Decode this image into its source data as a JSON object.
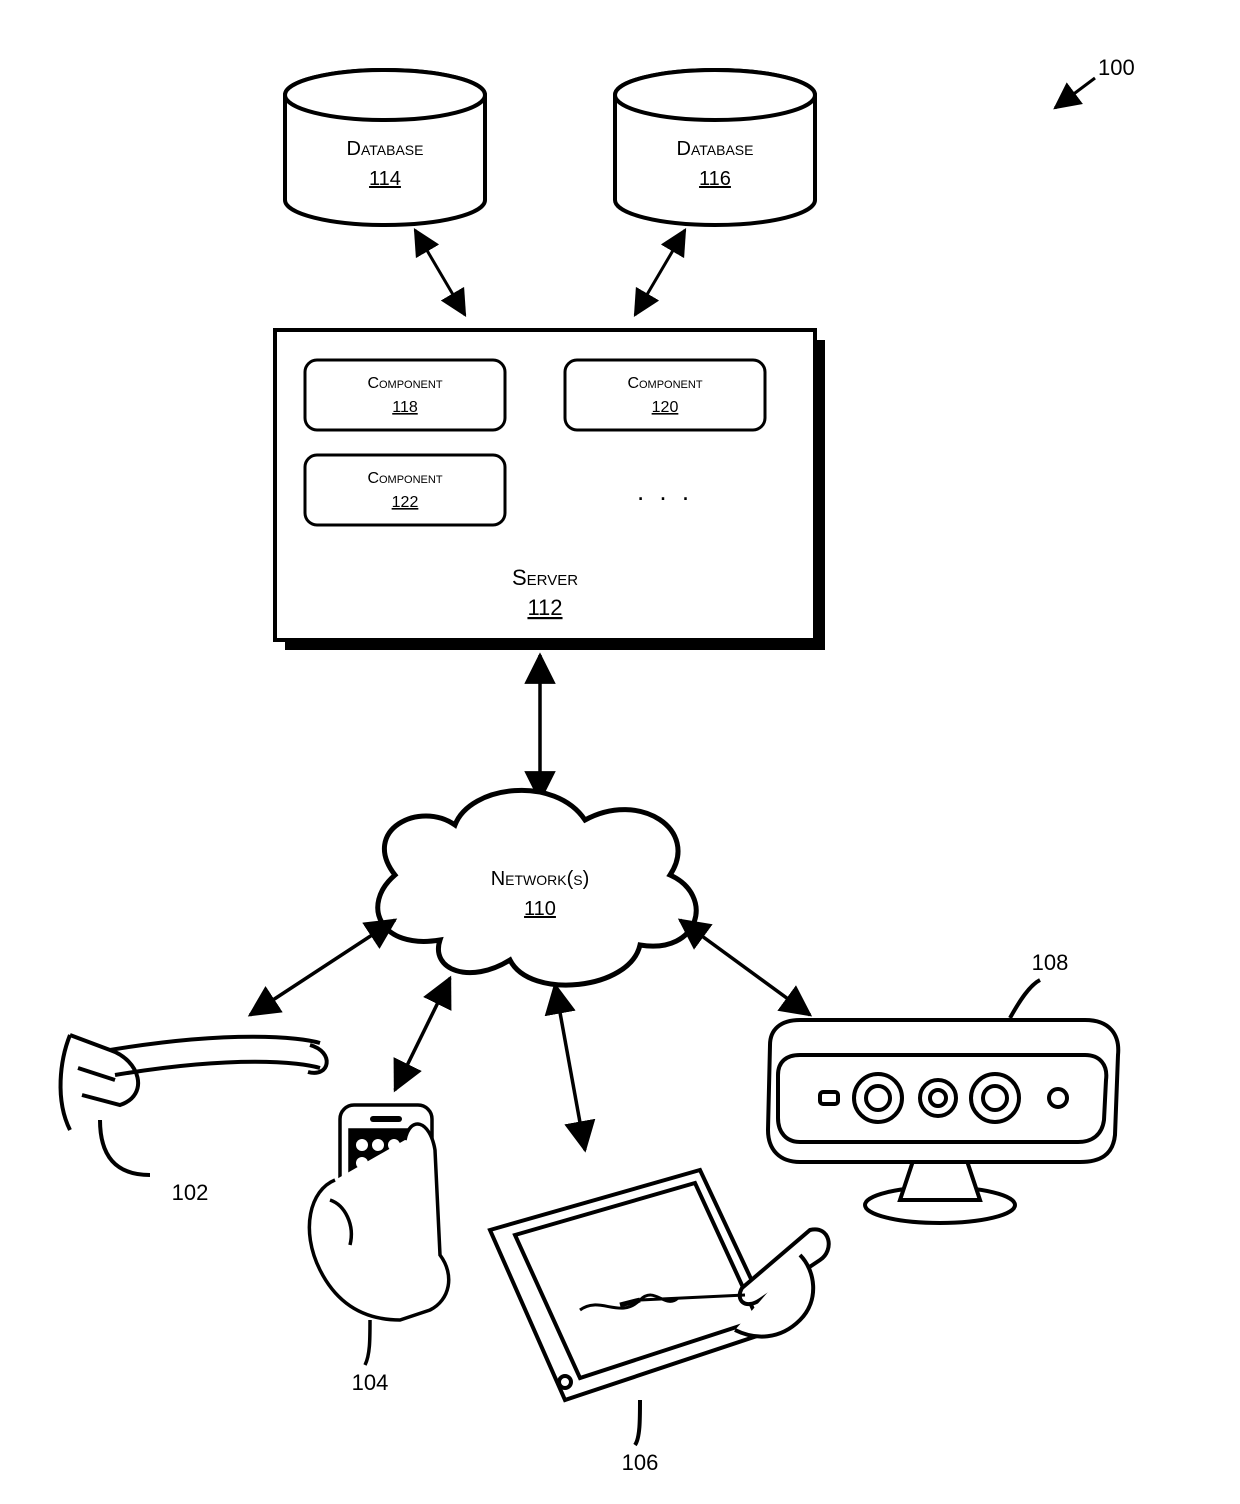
{
  "system_ref": "100",
  "databases": [
    {
      "label": "Database",
      "ref": "114"
    },
    {
      "label": "Database",
      "ref": "116"
    }
  ],
  "server": {
    "label": "Server",
    "ref": "112",
    "ellipsis": ". . .",
    "components": [
      {
        "label": "Component",
        "ref": "118"
      },
      {
        "label": "Component",
        "ref": "120"
      },
      {
        "label": "Component",
        "ref": "122"
      }
    ]
  },
  "network": {
    "label": "Network(s)",
    "ref": "110"
  },
  "clients": {
    "glasses_ref": "102",
    "phone_ref": "104",
    "tablet_ref": "106",
    "sensor_ref": "108"
  }
}
